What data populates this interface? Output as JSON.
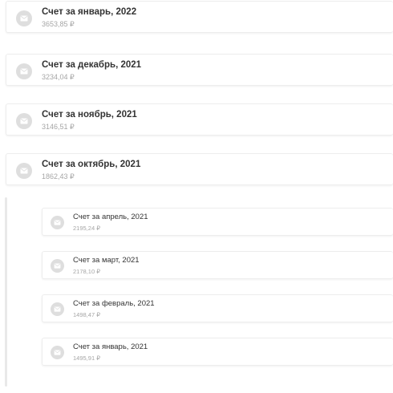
{
  "invoices": [
    {
      "title": "Счет за январь, 2022",
      "amount": "3653,85 ₽"
    },
    {
      "title": "Счет за декабрь, 2021",
      "amount": "3234,04 ₽"
    },
    {
      "title": "Счет за ноябрь, 2021",
      "amount": "3146,51 ₽"
    },
    {
      "title": "Счет за октябрь, 2021",
      "amount": "1862,43 ₽"
    }
  ],
  "nested_invoices": [
    {
      "title": "Счет за апрель, 2021",
      "amount": "2195,24 ₽"
    },
    {
      "title": "Счет за март, 2021",
      "amount": "2178,10 ₽"
    },
    {
      "title": "Счет за февраль, 2021",
      "amount": "1498,47 ₽"
    },
    {
      "title": "Счет за январь, 2021",
      "amount": "1495,91 ₽"
    }
  ],
  "colors": {
    "icon_bg": "#dedede",
    "title": "#333333",
    "amount": "#a6a6a6"
  },
  "icon": "envelope-icon"
}
